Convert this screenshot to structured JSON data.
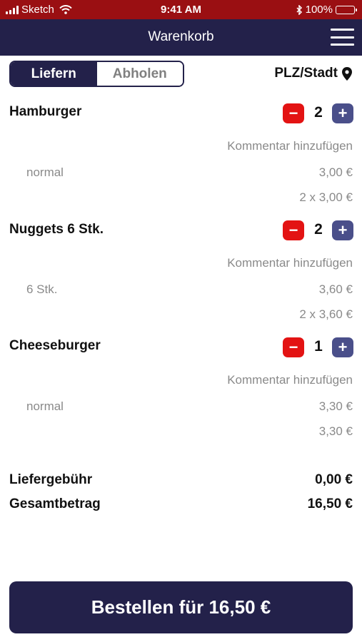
{
  "status_bar": {
    "carrier": "Sketch",
    "time": "9:41 AM",
    "battery": "100%",
    "icons": [
      "signal-icon",
      "wifi-icon",
      "bluetooth-icon",
      "battery-icon"
    ]
  },
  "header": {
    "title": "Warenkorb",
    "menu_icon": "hamburger-menu-icon"
  },
  "mode_toggle": {
    "options": [
      "Liefern",
      "Abholen"
    ],
    "selected": "Liefern"
  },
  "location": {
    "label": "PLZ/Stadt",
    "icon": "map-pin-icon"
  },
  "cart": {
    "items": [
      {
        "name": "Hamburger",
        "qty": "2",
        "comment_link": "Kommentar hinzufügen",
        "variant": "normal",
        "unit_price": "3,00 €",
        "line_total": "2 x 3,00 €"
      },
      {
        "name": "Nuggets 6 Stk.",
        "qty": "2",
        "comment_link": "Kommentar hinzufügen",
        "variant": "6 Stk.",
        "unit_price": "3,60 €",
        "line_total": "2 x 3,60 €"
      },
      {
        "name": "Cheeseburger",
        "qty": "1",
        "comment_link": "Kommentar hinzufügen",
        "variant": "normal",
        "unit_price": "3,30 €",
        "line_total": "3,30 €"
      }
    ]
  },
  "summary": {
    "delivery_fee_label": "Liefergebühr",
    "delivery_fee_value": "0,00 €",
    "total_label": "Gesamtbetrag",
    "total_value": "16,50 €"
  },
  "order_button": {
    "label": "Bestellen für 16,50 €"
  },
  "colors": {
    "status_bar": "#9a0f12",
    "nav_bar": "#23214a",
    "minus_button": "#e31313",
    "plus_button": "#4a4f8a",
    "muted_text": "#8a8a8a"
  }
}
